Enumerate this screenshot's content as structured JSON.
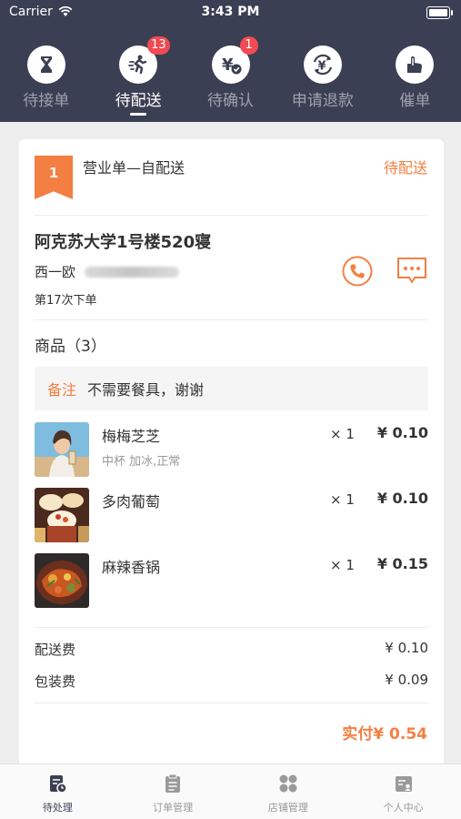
{
  "status_bar": {
    "carrier": "Carrier",
    "time": "3:43 PM"
  },
  "top_tabs": [
    {
      "label": "待接单",
      "icon": "hourglass-icon",
      "badge": "",
      "active": false
    },
    {
      "label": "待配送",
      "icon": "runner-icon",
      "badge": "13",
      "active": true
    },
    {
      "label": "待确认",
      "icon": "yen-check-icon",
      "badge": "1",
      "active": false
    },
    {
      "label": "申请退款",
      "icon": "yen-refund-icon",
      "badge": "",
      "active": false
    },
    {
      "label": "催单",
      "icon": "hand-pointer-icon",
      "badge": "",
      "active": false
    }
  ],
  "order": {
    "number": "1",
    "type": "营业单—自配送",
    "status": "待配送",
    "address": "阿克苏大学1号楼520寝",
    "customer_name": "西一欧",
    "order_count": "第17次下单",
    "goods_title": "商品（3）",
    "note_label": "备注",
    "note_text": "不需要餐具，谢谢",
    "items": [
      {
        "name": "梅梅芝芝",
        "spec": "中杯 加冰,正常",
        "qty": "× 1",
        "price": "¥ 0.10",
        "image": "woman-drink-photo"
      },
      {
        "name": "多肉葡萄",
        "spec": "",
        "qty": "× 1",
        "price": "¥ 0.10",
        "image": "fruit-tea-photo"
      },
      {
        "name": "麻辣香锅",
        "spec": "",
        "qty": "× 1",
        "price": "¥ 0.15",
        "image": "spicy-pot-photo"
      }
    ],
    "fees": [
      {
        "label": "配送费",
        "value": "¥ 0.10"
      },
      {
        "label": "包装费",
        "value": "¥ 0.09"
      }
    ],
    "total": "实付¥ 0.54"
  },
  "colors": {
    "header_bg": "#3b3f53",
    "accent": "#f47f42",
    "badge": "#f04a52"
  },
  "bottom_nav": [
    {
      "label": "待处理",
      "icon": "pending-icon",
      "active": true
    },
    {
      "label": "订单管理",
      "icon": "clipboard-icon",
      "active": false
    },
    {
      "label": "店铺管理",
      "icon": "grid-icon",
      "active": false
    },
    {
      "label": "个人中心",
      "icon": "profile-card-icon",
      "active": false
    }
  ]
}
